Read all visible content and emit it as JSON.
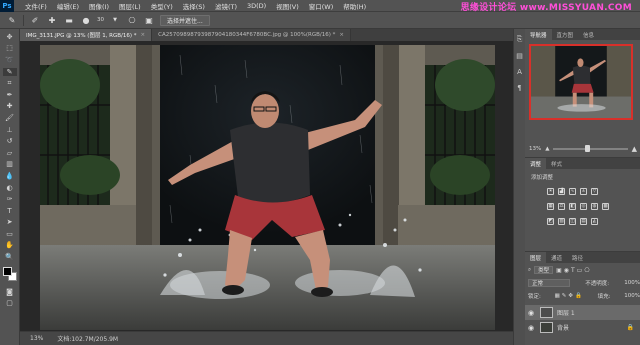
{
  "app": {
    "logo": "Ps"
  },
  "menubar": {
    "items": [
      "文件(F)",
      "编辑(E)",
      "图像(I)",
      "图层(L)",
      "类型(Y)",
      "选择(S)",
      "滤镜(T)",
      "3D(D)",
      "视图(V)",
      "窗口(W)",
      "帮助(H)"
    ]
  },
  "watermark": "思缘设计论坛 www.MISSYUAN.COM",
  "options": {
    "icons": [
      "quick-selection-icon",
      "new-selection-icon",
      "add-selection-icon",
      "subtract-selection-icon",
      "brush-preset-icon",
      "sample-all-icon",
      "auto-enhance-icon"
    ],
    "brush_size": "30",
    "select_subject_label": "选择并遮住..."
  },
  "tabs": [
    {
      "label": "IMG_3131.JPG @ 13% (图层 1, RGB/16) *",
      "active": true
    },
    {
      "label": "CA25709898793987904180344F6780BC.jpg @ 100%(RGB/16) *",
      "active": false
    }
  ],
  "status": {
    "zoom": "13%",
    "doc": "文档:102.7M/205.9M"
  },
  "tools": [
    "move-tool-icon",
    "marquee-tool-icon",
    "lasso-tool-icon",
    "quick-selection-tool-icon",
    "crop-tool-icon",
    "eyedropper-tool-icon",
    "healing-brush-tool-icon",
    "brush-tool-icon",
    "clone-stamp-tool-icon",
    "history-brush-tool-icon",
    "eraser-tool-icon",
    "gradient-tool-icon",
    "blur-tool-icon",
    "dodge-tool-icon",
    "pen-tool-icon",
    "type-tool-icon",
    "path-selection-tool-icon",
    "rectangle-tool-icon",
    "hand-tool-icon",
    "zoom-tool-icon"
  ],
  "colors": {
    "foreground": "#000000",
    "background": "#ffffff",
    "nav_box": "#d8302a",
    "watermark": "#ff4fd8"
  },
  "navigator": {
    "tabs": [
      "导航器",
      "直方图",
      "信息"
    ],
    "zoom": "13%"
  },
  "adjustments": {
    "tabs": [
      "调整",
      "样式"
    ],
    "title": "添加调整"
  },
  "layers": {
    "tabs": [
      "图层",
      "通道",
      "路径"
    ],
    "kind_label": "类型",
    "blend_mode": "正常",
    "opacity_label": "不透明度:",
    "opacity_value": "100%",
    "lock_label": "锁定:",
    "fill_label": "填充:",
    "fill_value": "100%",
    "items": [
      {
        "name": "图层 1",
        "visible": true,
        "selected": true
      },
      {
        "name": "背景",
        "visible": true,
        "selected": false
      }
    ]
  }
}
